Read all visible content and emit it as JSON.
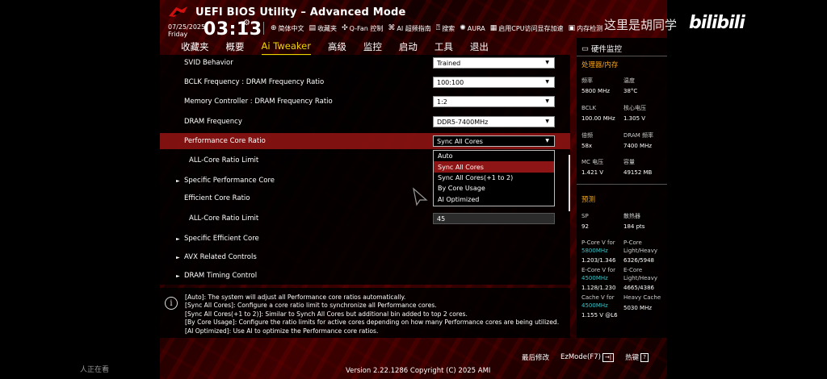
{
  "header": {
    "title": "UEFI BIOS Utility – Advanced Mode",
    "date": "07/25/2025",
    "weekday": "Friday",
    "time": "03:13",
    "toolbar": [
      {
        "icon": "globe-icon",
        "label": "简体中文"
      },
      {
        "icon": "favorites-icon",
        "label": "收藏夹"
      },
      {
        "icon": "fan-icon",
        "label": "Q-Fan 控制"
      },
      {
        "icon": "ai-overclock-icon",
        "label": "AI 超频指南"
      },
      {
        "icon": "search-icon",
        "label": "搜索"
      },
      {
        "icon": "aura-icon",
        "label": "AURA"
      },
      {
        "icon": "memory-icon",
        "label": "启用CPU访问显存加速"
      },
      {
        "icon": "memory-test-icon",
        "label": "内存检测"
      }
    ]
  },
  "tabs": [
    "收藏夹",
    "概要",
    "Ai Tweaker",
    "高级",
    "监控",
    "启动",
    "工具",
    "退出"
  ],
  "active_tab": "Ai Tweaker",
  "settings": {
    "svid": {
      "label": "SVID Behavior",
      "value": "Trained"
    },
    "bclk_ratio": {
      "label": "BCLK Frequency : DRAM Frequency Ratio",
      "value": "100:100"
    },
    "mc_ratio": {
      "label": "Memory Controller : DRAM Frequency Ratio",
      "value": "1:2"
    },
    "dram_freq": {
      "label": "DRAM Frequency",
      "value": "DDR5-7400MHz"
    },
    "pcore_ratio": {
      "label": "Performance Core Ratio",
      "value": "Sync All Cores"
    },
    "allcore_limit": {
      "label": "ALL-Core Ratio Limit"
    },
    "specific_perf": {
      "label": "Specific Performance Core"
    },
    "ecore_ratio": {
      "label": "Efficient Core Ratio"
    },
    "allcore_limit2": {
      "label": "ALL-Core Ratio Limit",
      "value": "45"
    },
    "specific_eff": {
      "label": "Specific Efficient Core"
    },
    "avx": {
      "label": "AVX Related Controls"
    },
    "dram_timing": {
      "label": "DRAM Timing Control"
    }
  },
  "dropdown_options": [
    "Auto",
    "Sync All Cores",
    "Sync All Cores(+1 to 2)",
    "By Core Usage",
    "AI Optimized"
  ],
  "dropdown_selected": "Sync All Cores",
  "help_lines": [
    "[Auto]: The system will adjust all Performance core ratios automatically.",
    "[Sync All Cores]: Configure a core ratio limit to synchronize all Performance cores.",
    "[Sync All Cores(+1 to 2)]: Similar to Synch All Cores but additional bin added to top 2 cores.",
    "[By Core Usage]: Configure the ratio limits for active cores depending on how many Performance cores are being utilized.",
    "[AI Optimized]: Use AI to optimize the Performance core ratios."
  ],
  "hw_monitor": {
    "title": "硬件监控",
    "section_cpu": "处理器/内存",
    "freq_label": "频率",
    "freq_value": "5800 MHz",
    "temp_label": "温度",
    "temp_value": "38°C",
    "bclk_label": "BCLK",
    "bclk_value": "100.00 MHz",
    "corev_label": "核心电压",
    "corev_value": "1.305 V",
    "ratio_label": "倍频",
    "ratio_value": "58x",
    "dram_label": "DRAM 频率",
    "dram_value": "7400 MHz",
    "mcv_label": "MC 电压",
    "mcv_value": "1.421 V",
    "cap_label": "容量",
    "cap_value": "49152 MB",
    "section_pred": "预测",
    "sp_label": "SP",
    "sp_value": "92",
    "heat_label": "散热器",
    "heat_value": "184 pts",
    "pcorev_label": "P-Core V for",
    "pcorev_freq": "5800MHz",
    "pcorev_value": "1.203/1.346",
    "pcorelh_label": "P-Core Light/Heavy",
    "pcorelh_value": "6326/5948",
    "ecorev_label": "E-Core V for",
    "ecorev_freq": "4500MHz",
    "ecorev_value": "1.128/1.230",
    "ecorelh_label": "E-Core Light/Heavy",
    "ecorelh_value": "4665/4386",
    "cachev_label": "Cache V for",
    "cachev_freq": "4500MHz",
    "cachev_value": "1.155 V @L6",
    "heavycache_label": "Heavy Cache",
    "heavycache_value": "5030 MHz"
  },
  "footer": {
    "last_modified": "最后修改",
    "ezmode": "EzMode(F7)",
    "hotkeys": "热键",
    "hotkeys_key": "?",
    "version": "Version 2.22.1286 Copyright (C) 2025 AMI"
  },
  "overlay": {
    "watermark": "这里是胡同学",
    "bilibili": "bilibili",
    "corner_note": "人正在看"
  },
  "colors": {
    "accent": "#f1d400",
    "highlight": "#8e1515",
    "section": "#f2a51a",
    "teal": "#38c5c9"
  }
}
